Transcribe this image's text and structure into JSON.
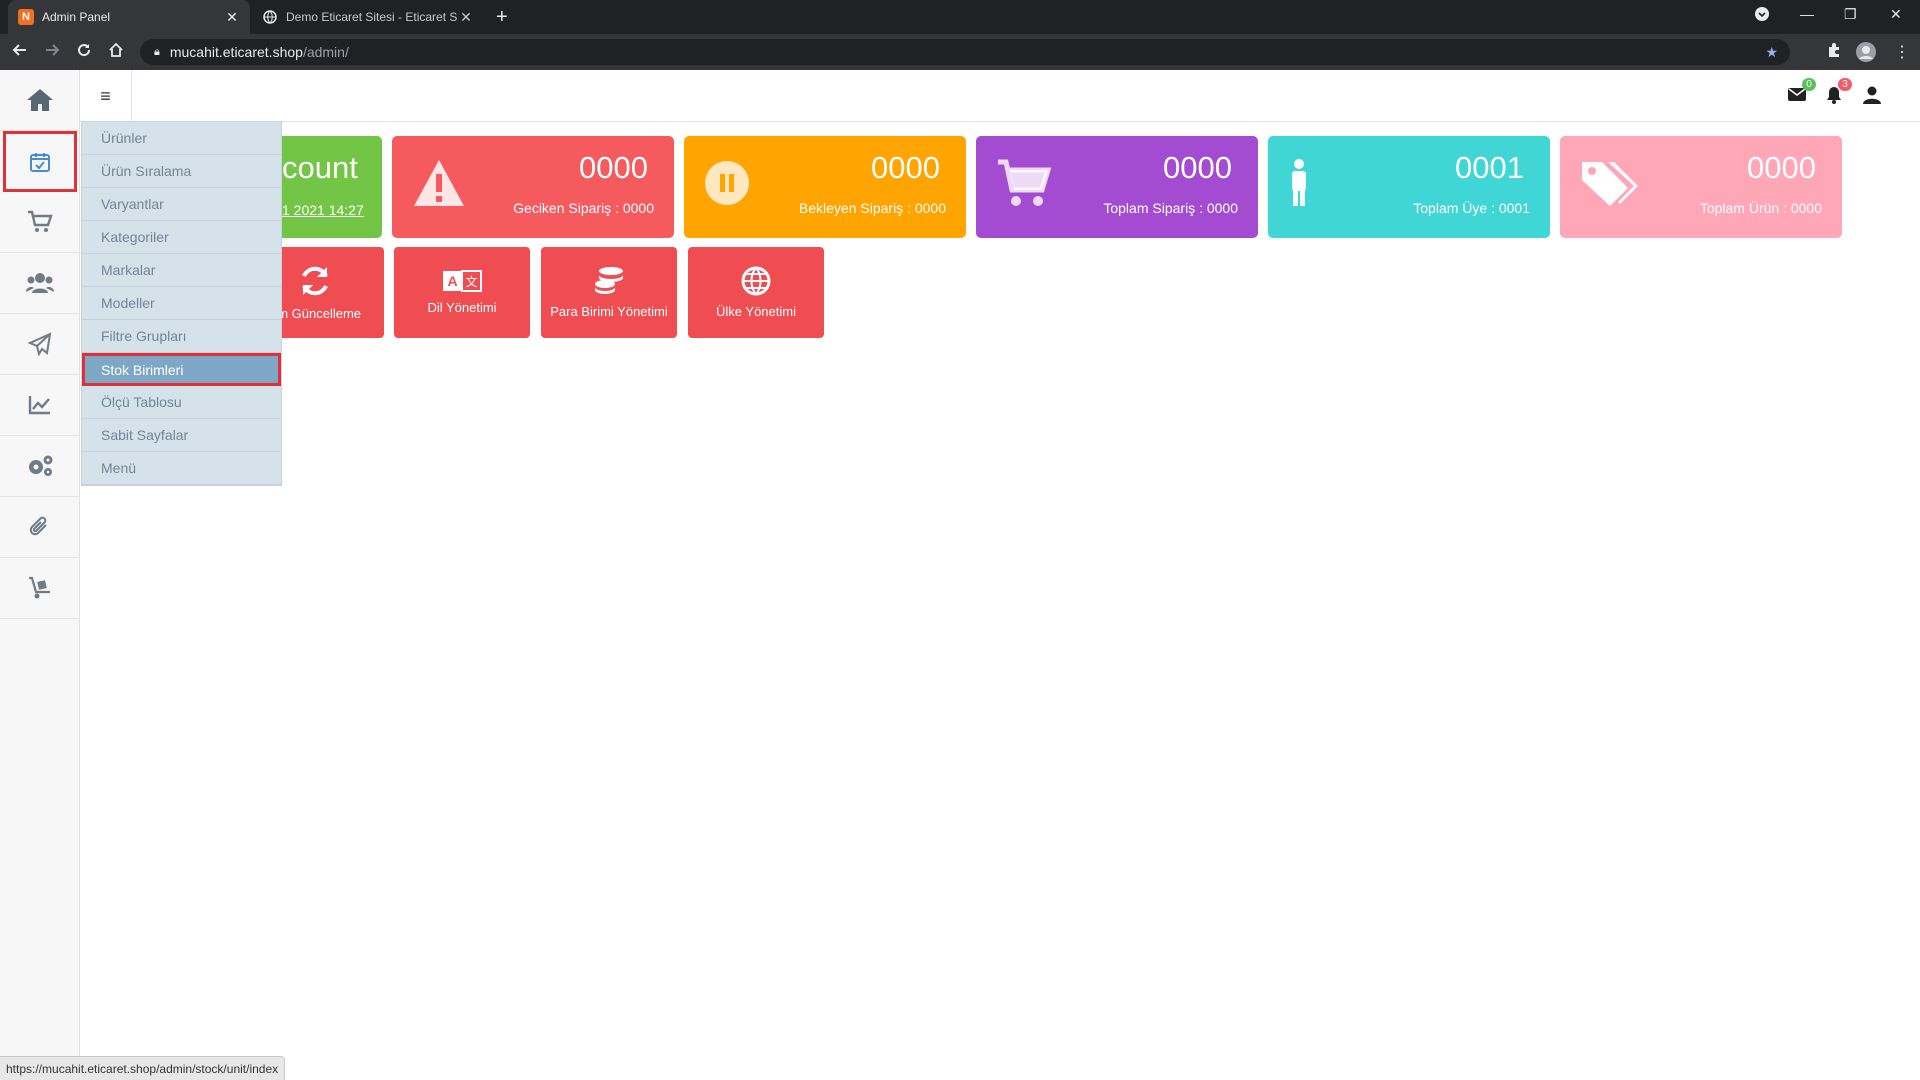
{
  "browser": {
    "tabs": [
      {
        "title": "Admin Panel",
        "favicon": "N",
        "active": true
      },
      {
        "title": "Demo Eticaret Sitesi - Eticaret Sh",
        "favicon": "globe",
        "active": false
      }
    ],
    "url_host": "mucahit.eticaret.shop",
    "url_path": "/admin/",
    "status_url": "https://mucahit.eticaret.shop/admin/stock/unit/index"
  },
  "topbar": {
    "mail_count": "0",
    "notif_count": "3"
  },
  "rail": [
    {
      "name": "home-icon"
    },
    {
      "name": "calendar-check-icon",
      "selected": true
    },
    {
      "name": "cart-icon"
    },
    {
      "name": "users-icon"
    },
    {
      "name": "paper-plane-icon"
    },
    {
      "name": "chart-line-icon"
    },
    {
      "name": "gears-icon"
    },
    {
      "name": "paperclip-icon"
    },
    {
      "name": "dolly-icon"
    }
  ],
  "dropdown": {
    "items": [
      "Ürünler",
      "Ürün Sıralama",
      "Varyantlar",
      "Kategoriler",
      "Markalar",
      "Modeller",
      "Filtre Grupları",
      "Stok Birimleri",
      "Ölçü Tablosu",
      "Sabit Sayfalar",
      "Menü"
    ],
    "active_index": 7
  },
  "partial_card": {
    "title": "count",
    "date": "1 2021 14:27",
    "color": "#73c545"
  },
  "stats": [
    {
      "value": "0000",
      "label": "Geciken Sipariş : 0000",
      "color": "#f55a5f",
      "icon": "warning-icon"
    },
    {
      "value": "0000",
      "label": "Bekleyen Sipariş : 0000",
      "color": "#ffa400",
      "icon": "pause-icon"
    },
    {
      "value": "0000",
      "label": "Toplam Sipariş : 0000",
      "color": "#a34bd1",
      "icon": "cart-icon"
    },
    {
      "value": "0001",
      "label": "Toplam Üye : 0001",
      "color": "#41d6d6",
      "icon": "person-icon"
    },
    {
      "value": "0000",
      "label": "Toplam Ürün : 0000",
      "color": "#ffa6b7",
      "icon": "tags-icon"
    }
  ],
  "tools": [
    {
      "label": "üm Güncelleme",
      "icon": "sync-icon"
    },
    {
      "label": "Dil Yönetimi",
      "icon": "language-icon"
    },
    {
      "label": "Para Birimi Yönetimi",
      "icon": "coins-icon"
    },
    {
      "label": "Ülke Yönetimi",
      "icon": "globe-icon"
    }
  ]
}
